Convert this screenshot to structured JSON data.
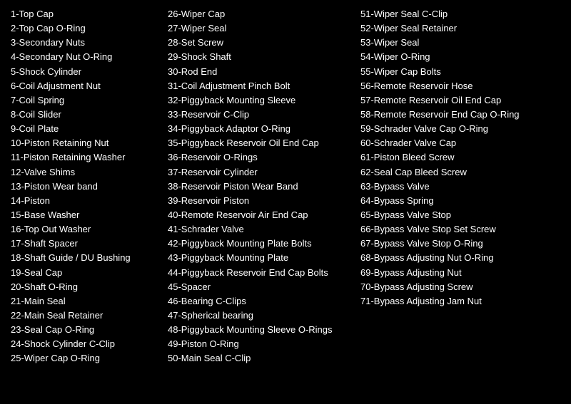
{
  "col1": {
    "items": [
      "1-Top Cap",
      "2-Top Cap O-Ring",
      "3-Secondary Nuts",
      "4-Secondary Nut O-Ring",
      "5-Shock Cylinder",
      "6-Coil Adjustment Nut",
      "7-Coil Spring",
      "8-Coil Slider",
      "9-Coil Plate",
      "10-Piston Retaining Nut",
      "11-Piston Retaining Washer",
      "12-Valve Shims",
      "13-Piston Wear band",
      "14-Piston",
      "15-Base Washer",
      "16-Top Out Washer",
      "17-Shaft Spacer",
      "18-Shaft Guide / DU Bushing",
      "19-Seal Cap",
      "20-Shaft O-Ring",
      "21-Main Seal",
      "22-Main Seal Retainer",
      "23-Seal Cap O-Ring",
      "24-Shock Cylinder C-Clip",
      "25-Wiper Cap O-Ring"
    ]
  },
  "col2": {
    "items": [
      "26-Wiper Cap",
      "27-Wiper Seal",
      "28-Set Screw",
      "29-Shock Shaft",
      "30-Rod End",
      "31-Coil Adjustment Pinch Bolt",
      "32-Piggyback Mounting Sleeve",
      "33-Reservoir C-Clip",
      "34-Piggyback Adaptor O-Ring",
      "35-Piggyback Reservoir Oil End Cap",
      "36-Reservoir O-Rings",
      "37-Reservoir Cylinder",
      "38-Reservoir Piston Wear Band",
      "39-Reservoir Piston",
      "40-Remote Reservoir Air End Cap",
      "41-Schrader Valve",
      "42-Piggyback Mounting Plate Bolts",
      "43-Piggyback Mounting Plate",
      "44-Piggyback Reservoir End Cap Bolts",
      "45-Spacer",
      "46-Bearing C-Clips",
      "47-Spherical bearing",
      "48-Piggyback Mounting Sleeve O-Rings",
      "49-Piston O-Ring",
      "50-Main Seal C-Clip"
    ]
  },
  "col3": {
    "items": [
      "51-Wiper Seal C-Clip",
      "52-Wiper Seal Retainer",
      "53-Wiper Seal",
      "54-Wiper O-Ring",
      "55-Wiper Cap Bolts",
      "56-Remote Reservoir Hose",
      "57-Remote Reservoir Oil End Cap",
      "58-Remote Reservoir End Cap O-Ring",
      "59-Schrader Valve Cap O-Ring",
      "60-Schrader Valve Cap",
      "61-Piston Bleed Screw",
      "62-Seal Cap Bleed Screw",
      "63-Bypass Valve",
      "64-Bypass Spring",
      "65-Bypass Valve Stop",
      "66-Bypass Valve Stop Set Screw",
      "67-Bypass Valve Stop O-Ring",
      "68-Bypass Adjusting Nut O-Ring",
      "69-Bypass Adjusting Nut",
      "70-Bypass Adjusting Screw",
      "71-Bypass Adjusting Jam Nut"
    ]
  }
}
